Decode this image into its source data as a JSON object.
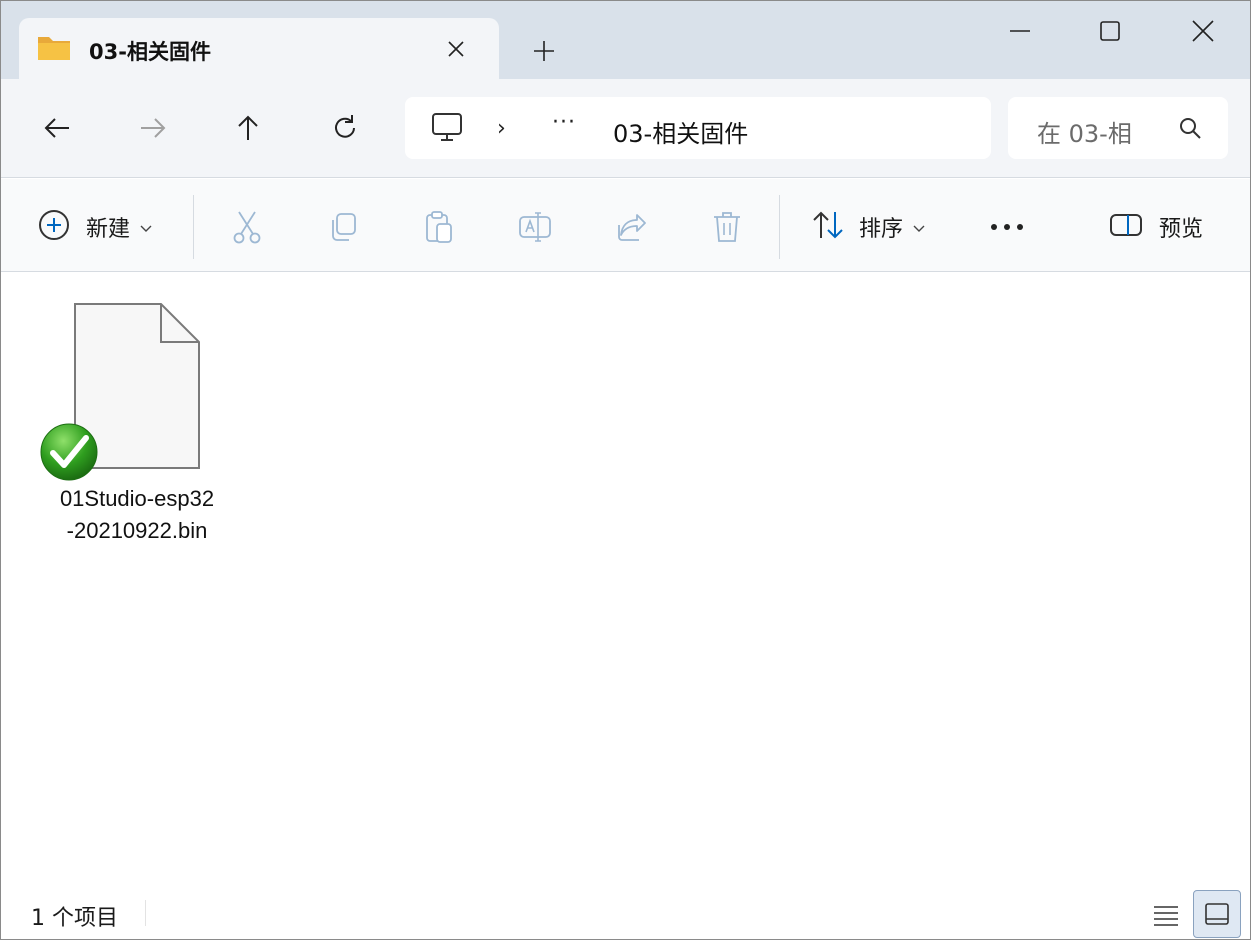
{
  "window": {
    "tab_title": "03-相关固件",
    "controls": {
      "minimize": "minimize-icon",
      "maximize": "maximize-icon",
      "close": "close-icon"
    }
  },
  "navigation": {
    "back_icon": "arrow-left-icon",
    "forward_icon": "arrow-right-icon",
    "up_icon": "arrow-up-icon",
    "refresh_icon": "refresh-icon"
  },
  "address_bar": {
    "root_icon": "this-pc-icon",
    "overflow": "···",
    "current_path": "03-相关固件"
  },
  "search": {
    "placeholder": "在 03-相"
  },
  "command_bar": {
    "new_label": "新建",
    "sort_label": "排序",
    "more_label": "•••",
    "preview_label": "预览",
    "disabled_actions": [
      "cut",
      "copy",
      "paste",
      "rename",
      "share",
      "delete"
    ]
  },
  "files": [
    {
      "name_line1": "01Studio-esp32",
      "name_line2": "-20210922.bin",
      "icon": "document-icon",
      "badge": "sync-check-icon"
    }
  ],
  "status_bar": {
    "item_count": "1 个项目",
    "view_active": "tiles"
  },
  "colors": {
    "accent": "#0067c0",
    "disabled_icon": "#9db8d3",
    "badge_green": "#2f9e1f",
    "folder_yellow": "#f6c244"
  }
}
